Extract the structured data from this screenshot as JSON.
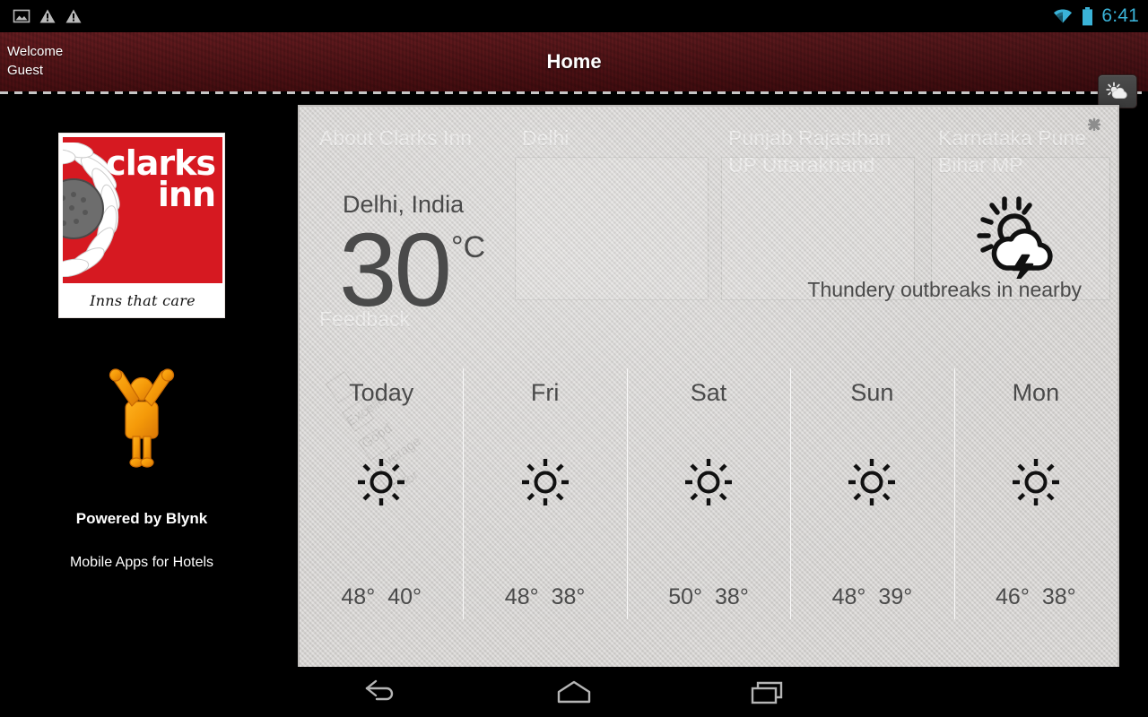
{
  "statusbar": {
    "icons": [
      "image-icon",
      "warning-icon",
      "warning-icon"
    ],
    "wifi_icon": "wifi-icon",
    "battery_icon": "battery-icon",
    "clock": "6:41",
    "clock_color": "#3ab3d8"
  },
  "titlebar": {
    "welcome_line1": "Welcome",
    "welcome_line2": "Guest",
    "title": "Home",
    "weather_button_icon": "sun-behind-cloud-icon"
  },
  "sidebar": {
    "logo": {
      "brand_line1": "clarks",
      "brand_line2": "inn",
      "tagline": "Inns that care",
      "flower_icon": "sunflower-icon",
      "brand_red": "#d61921"
    },
    "mascot_icon": "celebrating-person-icon",
    "powered_by": "Powered by Blynk",
    "tagline": "Mobile Apps for Hotels"
  },
  "weather_panel": {
    "close_icon": "close-icon",
    "city": "Delhi, India",
    "temperature": "30",
    "unit": "°C",
    "condition_icon": "sun-cloud-lightning-icon",
    "condition_text": "Thundery outbreaks in nearby",
    "forecast": [
      {
        "day": "Today",
        "icon": "sun-icon",
        "high": "48°",
        "low": "40°"
      },
      {
        "day": "Fri",
        "icon": "sun-icon",
        "high": "48°",
        "low": "38°"
      },
      {
        "day": "Sat",
        "icon": "sun-icon",
        "high": "50°",
        "low": "38°"
      },
      {
        "day": "Sun",
        "icon": "sun-icon",
        "high": "48°",
        "low": "39°"
      },
      {
        "day": "Mon",
        "icon": "sun-icon",
        "high": "46°",
        "low": "38°"
      }
    ],
    "background_page": {
      "tile1": "About Clarks Inn",
      "tile2": "Delhi",
      "tile3": "Punjab Rajasthan\nUP Uttarakhand",
      "tile4": "Karnataka Pune\nBihar MP",
      "tile5": "Feedback",
      "feedback_options": [
        "Excellent",
        "Good",
        "Average",
        "Poor"
      ]
    }
  },
  "navbar": {
    "back_icon": "back-arrow-icon",
    "home_icon": "home-icon",
    "recents_icon": "recent-apps-icon"
  }
}
